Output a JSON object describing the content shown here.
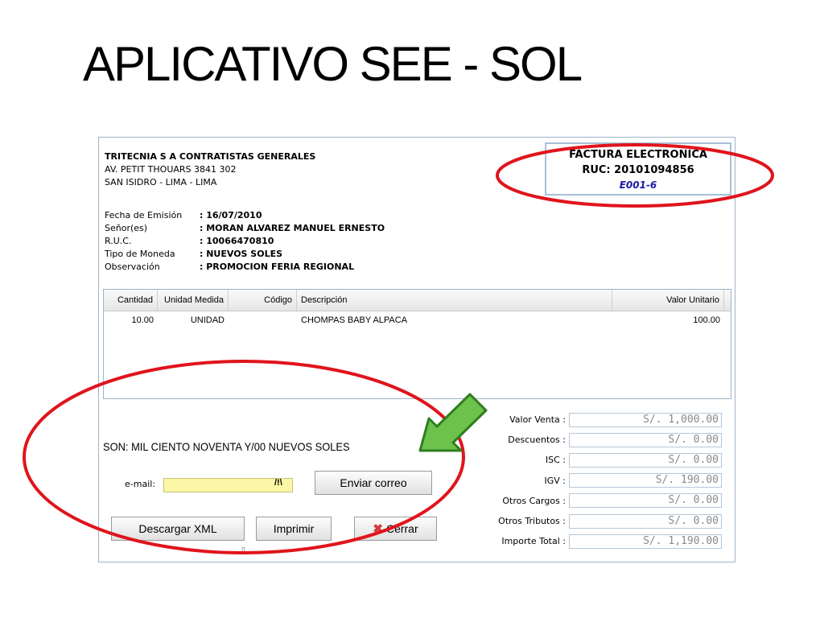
{
  "slide": {
    "title": "APLICATIVO SEE - SOL"
  },
  "company": {
    "name": "TRITECNIA S A CONTRATISTAS GENERALES",
    "address1": "AV. PETIT THOUARS 3841 302",
    "address2": "SAN ISIDRO - LIMA - LIMA"
  },
  "document": {
    "type": "FACTURA ELECTRONICA",
    "ruc": "RUC: 20101094856",
    "number": "E001-6"
  },
  "meta": [
    {
      "label": "Fecha de Emisión",
      "value": ": 16/07/2010"
    },
    {
      "label": "Señor(es)",
      "value": ": MORAN ALVAREZ MANUEL ERNESTO"
    },
    {
      "label": "R.U.C.",
      "value": ": 10066470810"
    },
    {
      "label": "Tipo de Moneda",
      "value": ": NUEVOS SOLES"
    },
    {
      "label": "Observación",
      "value": ": PROMOCION FERIA REGIONAL"
    }
  ],
  "table": {
    "headers": [
      "Cantidad",
      "Unidad Medida",
      "Código",
      "Descripción",
      "Valor Unitario"
    ],
    "rows": [
      [
        "10.00",
        "UNIDAD",
        "",
        "CHOMPAS BABY ALPACA",
        "100.00"
      ]
    ]
  },
  "son_text": "SON: MIL CIENTO NOVENTA Y/00 NUEVOS SOLES",
  "email": {
    "label": "e-mail:",
    "value": "",
    "warning": "/!\\"
  },
  "buttons": {
    "enviar": "Enviar correo",
    "descargar": "Descargar XML",
    "imprimir": "Imprimir",
    "cerrar": "Cerrar"
  },
  "tiny_mark": "▯",
  "totals": [
    {
      "label": "Valor Venta :",
      "value": "S/. 1,000.00"
    },
    {
      "label": "Descuentos :",
      "value": "S/. 0.00"
    },
    {
      "label": "ISC :",
      "value": "S/. 0.00"
    },
    {
      "label": "IGV :",
      "value": "S/. 190.00"
    },
    {
      "label": "Otros Cargos :",
      "value": "S/. 0.00"
    },
    {
      "label": "Otros Tributos :",
      "value": "S/. 0.00"
    },
    {
      "label": "Importe Total :",
      "value": "S/. 1,190.00"
    }
  ],
  "colors": {
    "highlight_ellipse": "#e0141c",
    "arrow_fill": "#6cc24a",
    "arrow_stroke": "#2e7d1f",
    "doc_number": "#1a1aa8"
  }
}
